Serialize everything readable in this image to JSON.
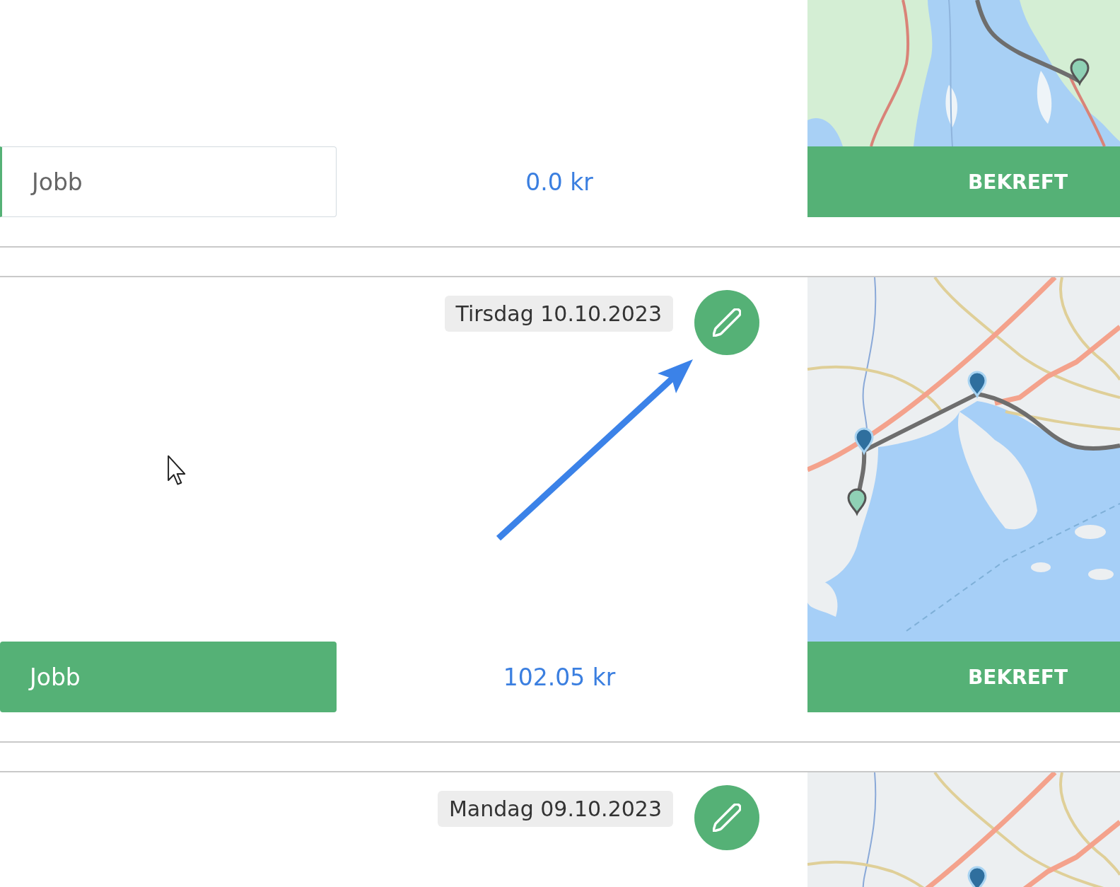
{
  "trips": [
    {
      "purpose": {
        "label": "Jobb",
        "selected": false
      },
      "amount": "0.0 kr",
      "confirm_label": "BEKREFT"
    },
    {
      "date": "Tirsdag 10.10.2023",
      "purpose": {
        "label": "Jobb",
        "selected": true
      },
      "amount": "102.05 kr",
      "confirm_label": "BEKREFT"
    },
    {
      "date": "Mandag 09.10.2023"
    }
  ]
}
